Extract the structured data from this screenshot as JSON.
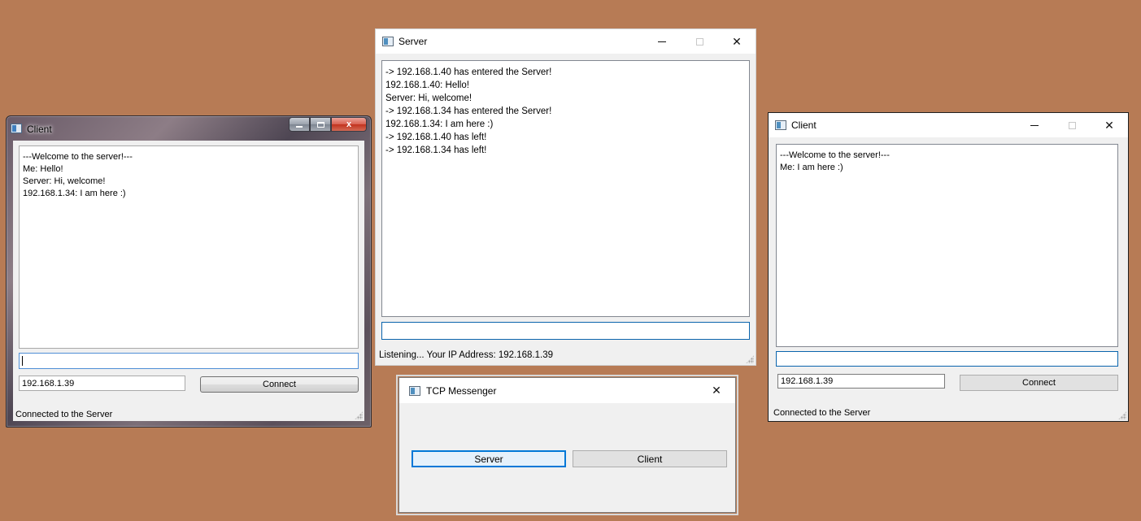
{
  "desktop": {
    "background": "#b77b55"
  },
  "client_left": {
    "title": "Client",
    "chat_lines": [
      "---Welcome to the server!---",
      "Me: Hello!",
      "Server: Hi, welcome!",
      "192.168.1.34: I am here :)"
    ],
    "message_value": "",
    "ip_value": "192.168.1.39",
    "connect_label": "Connect",
    "status": "Connected to the Server"
  },
  "server": {
    "title": "Server",
    "chat_lines": [
      "-> 192.168.1.40 has entered the Server!",
      "192.168.1.40: Hello!",
      "Server: Hi, welcome!",
      "-> 192.168.1.34 has entered the Server!",
      "192.168.1.34: I am here :)",
      "-> 192.168.1.40 has left!",
      "-> 192.168.1.34 has left!"
    ],
    "message_value": "",
    "status": "Listening... Your IP Address: 192.168.1.39"
  },
  "client_right": {
    "title": "Client",
    "chat_lines": [
      "---Welcome to the server!---",
      "Me: I am here :)"
    ],
    "message_value": "",
    "ip_value": "192.168.1.39",
    "connect_label": "Connect",
    "status": "Connected to the Server"
  },
  "tcp_messenger": {
    "title": "TCP Messenger",
    "server_label": "Server",
    "client_label": "Client"
  },
  "icons": {
    "close": "✕",
    "w7_close": "x"
  }
}
